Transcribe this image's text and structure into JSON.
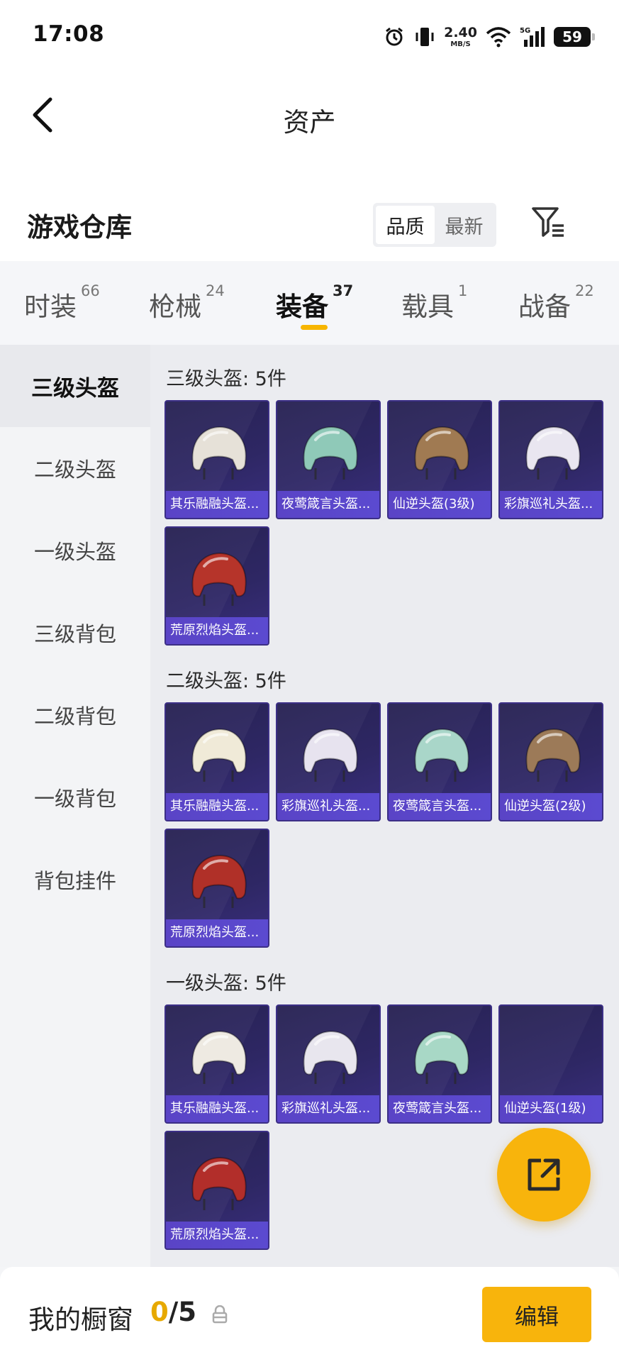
{
  "status_bar": {
    "time": "17:08",
    "net_speed": "2.40",
    "net_unit": "MB/S",
    "network": "5G",
    "battery": "59"
  },
  "header": {
    "title": "资产"
  },
  "warehouse": {
    "title": "游戏仓库",
    "sort_options": [
      "品质",
      "最新"
    ],
    "active_sort": "品质"
  },
  "category_tabs": [
    {
      "label": "时装",
      "count": "66"
    },
    {
      "label": "枪械",
      "count": "24"
    },
    {
      "label": "装备",
      "count": "37"
    },
    {
      "label": "载具",
      "count": "1"
    },
    {
      "label": "战备",
      "count": "22"
    }
  ],
  "active_tab": "装备",
  "sidebar": {
    "items": [
      "三级头盔",
      "二级头盔",
      "一级头盔",
      "三级背包",
      "二级背包",
      "一级背包",
      "背包挂件"
    ],
    "active": "三级头盔"
  },
  "sections": [
    {
      "title": "三级头盔: 5件",
      "items": [
        {
          "name": "其乐融融头盔...",
          "color": "#e6e1d8"
        },
        {
          "name": "夜莺箴言头盔...",
          "color": "#8fc9b8"
        },
        {
          "name": "仙逆头盔(3级)",
          "color": "#a07a52"
        },
        {
          "name": "彩旗巡礼头盔...",
          "color": "#e9e6f0"
        },
        {
          "name": "荒原烈焰头盔...",
          "color": "#b6342a"
        }
      ]
    },
    {
      "title": "二级头盔: 5件",
      "items": [
        {
          "name": "其乐融融头盔...",
          "color": "#f0ead8"
        },
        {
          "name": "彩旗巡礼头盔...",
          "color": "#e7e3ef"
        },
        {
          "name": "夜莺箴言头盔...",
          "color": "#a9d6c9"
        },
        {
          "name": "仙逆头盔(2级)",
          "color": "#9c7a58"
        },
        {
          "name": "荒原烈焰头盔...",
          "color": "#b03028"
        }
      ]
    },
    {
      "title": "一级头盔: 5件",
      "items": [
        {
          "name": "其乐融融头盔...",
          "color": "#eeeae2"
        },
        {
          "name": "彩旗巡礼头盔...",
          "color": "#e8e6ee"
        },
        {
          "name": "夜莺箴言头盔...",
          "color": "#a8d8c6"
        },
        {
          "name": "仙逆头盔(1级)",
          "color": ""
        },
        {
          "name": "荒原烈焰头盔...",
          "color": "#b22e2a"
        }
      ]
    }
  ],
  "showcase": {
    "title": "我的橱窗",
    "current": "0",
    "separator": "/",
    "total": "5",
    "edit_label": "编辑"
  },
  "colors": {
    "accent": "#f8b40c",
    "card_bg": "#2b245d",
    "card_label_bg": "#5a44c6"
  }
}
